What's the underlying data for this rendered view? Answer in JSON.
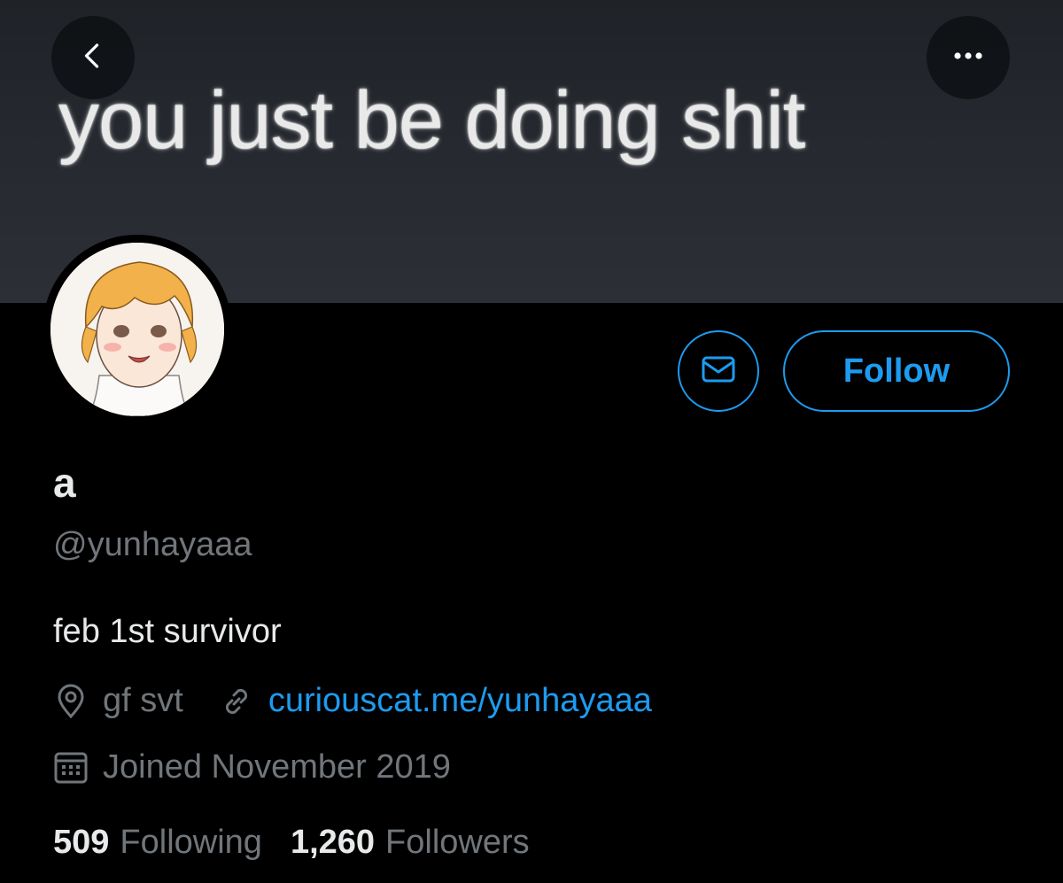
{
  "banner": {
    "text": "you just be doing shit"
  },
  "profile": {
    "name": "a",
    "handle": "@yunhayaaa",
    "bio": "feb 1st survivor",
    "location": "gf svt",
    "website": "curiouscat.me/yunhayaaa",
    "joined": "Joined November 2019"
  },
  "actions": {
    "follow_label": "Follow"
  },
  "stats": {
    "following_count": "509",
    "following_label": "Following",
    "followers_count": "1,260",
    "followers_label": "Followers"
  },
  "icons": {
    "back": "chevron-left-icon",
    "more": "more-horizontal-icon",
    "message": "envelope-icon",
    "location": "location-pin-icon",
    "link": "link-icon",
    "calendar": "calendar-icon"
  },
  "colors": {
    "accent": "#1d9bf0",
    "muted": "#71767b",
    "text": "#e7e9ea",
    "background": "#000000"
  }
}
